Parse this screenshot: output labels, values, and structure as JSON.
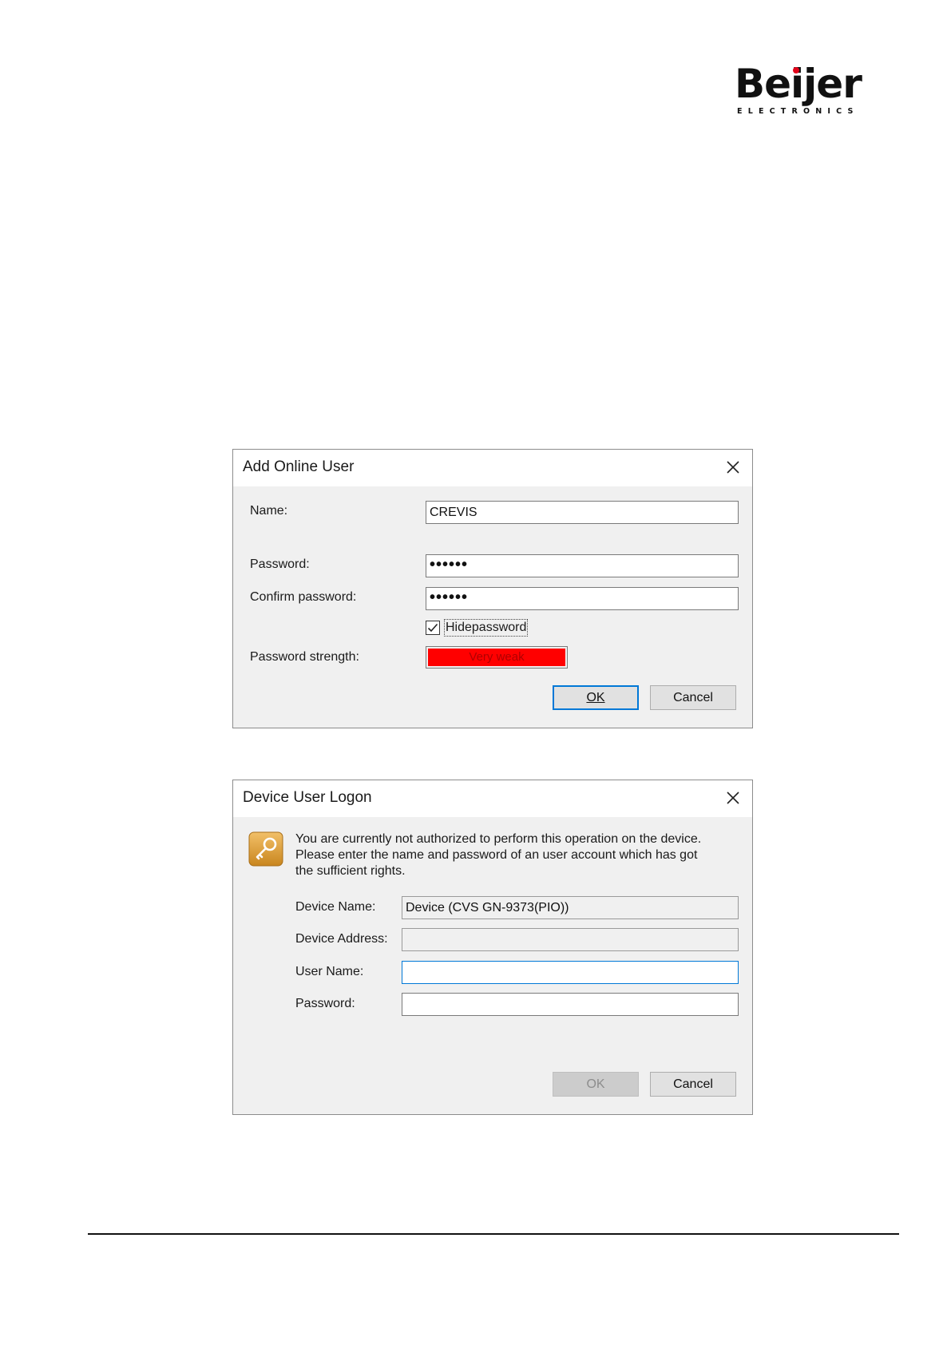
{
  "logo": {
    "text": "Beijer",
    "sub": "ELECTRONICS"
  },
  "add_user_dialog": {
    "title": "Add Online User",
    "name_label": "Name:",
    "name_value": "CREVIS",
    "password_label": "Password:",
    "password_value": "••••••",
    "confirm_label": "Confirm password:",
    "confirm_value": "••••••",
    "hide_password_label": "Hidepassword",
    "hide_password_checked": true,
    "strength_label": "Password strength:",
    "strength_value": "Very weak",
    "strength_color": "#ff0000",
    "ok_label": "OK",
    "cancel_label": "Cancel"
  },
  "logon_dialog": {
    "title": "Device User Logon",
    "message_lines": [
      "You are currently not authorized to perform this operation on the device.",
      "Please enter the name and password of an user account which has got",
      "the sufficient rights."
    ],
    "device_name_label": "Device Name:",
    "device_name_value": "Device (CVS GN-9373(PIO))",
    "device_address_label": "Device Address:",
    "device_address_value": "",
    "user_name_label": "User Name:",
    "user_name_value": "",
    "password_label": "Password:",
    "password_value": "",
    "ok_label": "OK",
    "cancel_label": "Cancel"
  },
  "colors": {
    "accent": "#0078d7",
    "logo_dot": "#e3051b",
    "key_icon": "#d9a03a"
  }
}
